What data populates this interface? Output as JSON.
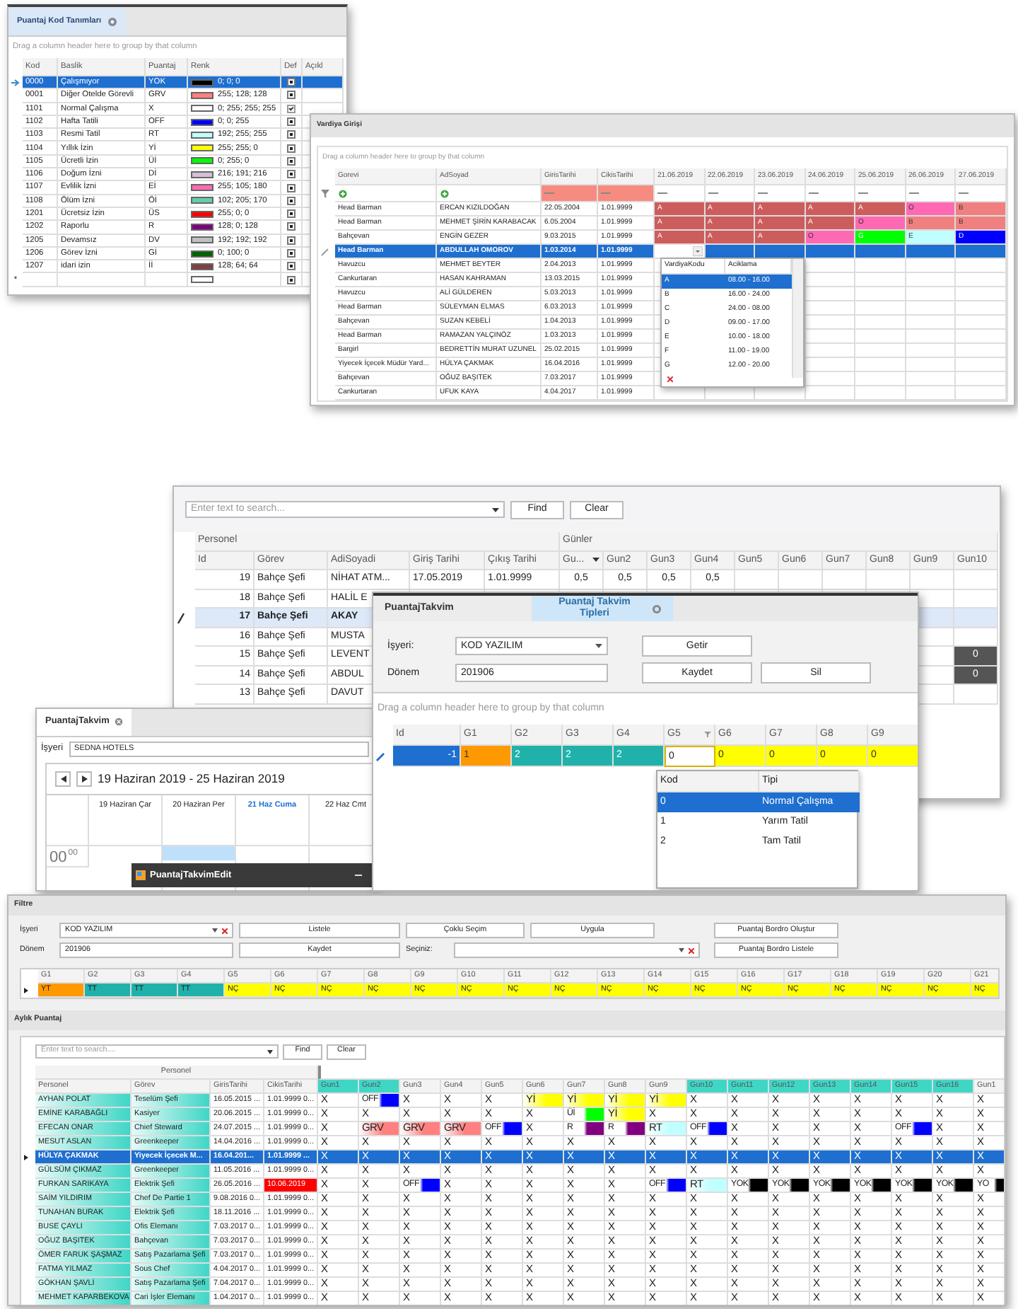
{
  "kod_tanimlari": {
    "tab": "Puantaj Kod Tanımları",
    "group_hint": "Drag a column header here to group by that column",
    "columns": [
      "Kod",
      "Baslik",
      "Puantaj",
      "Renk",
      "Def",
      "Açıkl"
    ],
    "rows": [
      {
        "kod": "0000",
        "baslik": "Çalışmıyor",
        "puantaj": "YOK",
        "color": "#000000",
        "renk": "0; 0; 0",
        "def": false,
        "selected": true
      },
      {
        "kod": "0001",
        "baslik": "Diğer Otelde Görevli",
        "puantaj": "GRV",
        "color": "#ff8080",
        "renk": "255; 128; 128",
        "def": false,
        "selected": false
      },
      {
        "kod": "1101",
        "baslik": "Normal Çalışma",
        "puantaj": "X",
        "color": "#ffffff",
        "renk": "0; 255; 255; 255",
        "def": true,
        "selected": false
      },
      {
        "kod": "1102",
        "baslik": "Hafta Tatili",
        "puantaj": "OFF",
        "color": "#0000ff",
        "renk": "0; 0; 255",
        "def": false,
        "selected": false
      },
      {
        "kod": "1103",
        "baslik": "Resmi Tatil",
        "puantaj": "RT",
        "color": "#c0ffff",
        "renk": "192; 255; 255",
        "def": false,
        "selected": false
      },
      {
        "kod": "1104",
        "baslik": "Yıllık İzin",
        "puantaj": "Yİ",
        "color": "#ffff00",
        "renk": "255; 255; 0",
        "def": false,
        "selected": false
      },
      {
        "kod": "1105",
        "baslik": "Ücretli İzin",
        "puantaj": "Üİ",
        "color": "#00ff00",
        "renk": "0; 255; 0",
        "def": false,
        "selected": false
      },
      {
        "kod": "1106",
        "baslik": "Doğum İzni",
        "puantaj": "Dİ",
        "color": "#d8bfd8",
        "renk": "216; 191; 216",
        "def": false,
        "selected": false
      },
      {
        "kod": "1107",
        "baslik": "Evlilik İzni",
        "puantaj": "Eİ",
        "color": "#ff69b4",
        "renk": "255; 105; 180",
        "def": false,
        "selected": false
      },
      {
        "kod": "1108",
        "baslik": "Ölüm İzni",
        "puantaj": "Öİ",
        "color": "#66cdaa",
        "renk": "102; 205; 170",
        "def": false,
        "selected": false
      },
      {
        "kod": "1201",
        "baslik": "Ücretsiz İzin",
        "puantaj": "ÜS",
        "color": "#ff0000",
        "renk": "255; 0; 0",
        "def": false,
        "selected": false
      },
      {
        "kod": "1202",
        "baslik": "Raporlu",
        "puantaj": "R",
        "color": "#800080",
        "renk": "128; 0; 128",
        "def": false,
        "selected": false
      },
      {
        "kod": "1205",
        "baslik": "Devamsız",
        "puantaj": "DV",
        "color": "#c0c0c0",
        "renk": "192; 192; 192",
        "def": false,
        "selected": false
      },
      {
        "kod": "1206",
        "baslik": "Görev İzni",
        "puantaj": "Gİ",
        "color": "#006400",
        "renk": "0; 100; 0",
        "def": false,
        "selected": false
      },
      {
        "kod": "1207",
        "baslik": "idari izin",
        "puantaj": "İİ",
        "color": "#804040",
        "renk": "128; 64; 64",
        "def": false,
        "selected": false
      }
    ],
    "new_row": {
      "marker": "*",
      "def": false
    }
  },
  "vardiya_girisi": {
    "title": "Vardiya Girişi",
    "group_hint": "Drag a column header here to group by that column",
    "columns": [
      "Gorevi",
      "AdSoyad",
      "GirisTarihi",
      "CikisTarihi",
      "21.06.2019",
      "22.06.2019",
      "23.06.2019",
      "24.06.2019",
      "25.06.2019",
      "26.06.2019",
      "27.06.2019"
    ],
    "rows": [
      {
        "gorevi": "Head Barman",
        "adsoyad": "ERCAN KIZILDOĞAN",
        "giris": "22.05.2004",
        "cikis": "1.01.9999",
        "selected": false,
        "editing": false,
        "shifts": [
          {
            "code": "A",
            "color": "#cd5c5c"
          },
          {
            "code": "A",
            "color": "#cd5c5c"
          },
          {
            "code": "A",
            "color": "#cd5c5c"
          },
          {
            "code": "A",
            "color": "#cd5c5c"
          },
          {
            "code": "A",
            "color": "#cd5c5c"
          },
          {
            "code": "O",
            "color": "#ff69b4"
          },
          {
            "code": "B",
            "color": "#f08080"
          }
        ]
      },
      {
        "gorevi": "Head Barman",
        "adsoyad": "MEHMET ŞİRİN KARABACAK",
        "giris": "6.05.2004",
        "cikis": "1.01.9999",
        "selected": false,
        "editing": false,
        "shifts": [
          {
            "code": "A",
            "color": "#cd5c5c"
          },
          {
            "code": "A",
            "color": "#cd5c5c"
          },
          {
            "code": "A",
            "color": "#cd5c5c"
          },
          {
            "code": "A",
            "color": "#cd5c5c"
          },
          {
            "code": "O",
            "color": "#ff69b4"
          },
          {
            "code": "B",
            "color": "#f08080"
          },
          {
            "code": "B",
            "color": "#f08080"
          }
        ]
      },
      {
        "gorevi": "Bahçevan",
        "adsoyad": "ENGİN GEZER",
        "giris": "9.03.2015",
        "cikis": "1.01.9999",
        "selected": false,
        "editing": false,
        "shifts": [
          {
            "code": "A",
            "color": "#cd5c5c"
          },
          {
            "code": "A",
            "color": "#cd5c5c"
          },
          {
            "code": "A",
            "color": "#cd5c5c"
          },
          {
            "code": "O",
            "color": "#ff69b4"
          },
          {
            "code": "G",
            "color": "#00ff00"
          },
          {
            "code": "E",
            "color": "#c0ffff"
          },
          {
            "code": "D",
            "color": "#0000ff"
          }
        ]
      },
      {
        "gorevi": "Head Barman",
        "adsoyad": "ABDULLAH OMOROV",
        "giris": "1.03.2014",
        "cikis": "1.01.9999",
        "selected": true,
        "editing": true,
        "shifts": []
      },
      {
        "gorevi": "Havuzcu",
        "adsoyad": "MEHMET BEYTER",
        "giris": "2.04.2013",
        "cikis": "1.01.9999",
        "selected": false,
        "editing": false,
        "shifts": []
      },
      {
        "gorevi": "Cankurtaran",
        "adsoyad": "HASAN KAHRAMAN",
        "giris": "13.03.2015",
        "cikis": "1.01.9999",
        "selected": false,
        "editing": false,
        "shifts": []
      },
      {
        "gorevi": "Havuzcu",
        "adsoyad": "ALİ GÜLDEREN",
        "giris": "5.03.2013",
        "cikis": "1.01.9999",
        "selected": false,
        "editing": false,
        "shifts": []
      },
      {
        "gorevi": "Head Barman",
        "adsoyad": "SÜLEYMAN ELMAS",
        "giris": "6.03.2013",
        "cikis": "1.01.9999",
        "selected": false,
        "editing": false,
        "shifts": []
      },
      {
        "gorevi": "Bahçevan",
        "adsoyad": "SUZAN KEBELİ",
        "giris": "1.04.2013",
        "cikis": "1.01.9999",
        "selected": false,
        "editing": false,
        "shifts": []
      },
      {
        "gorevi": "Head Barman",
        "adsoyad": "RAMAZAN YALÇINÖZ",
        "giris": "1.03.2013",
        "cikis": "1.01.9999",
        "selected": false,
        "editing": false,
        "shifts": []
      },
      {
        "gorevi": "Bargirl",
        "adsoyad": "BEDRETTİN MURAT UZUNEL",
        "giris": "25.02.2015",
        "cikis": "1.01.9999",
        "selected": false,
        "editing": false,
        "shifts": []
      },
      {
        "gorevi": "Yiyecek İçecek Müdür Yard...",
        "adsoyad": "HÜLYA ÇAKMAK",
        "giris": "16.04.2016",
        "cikis": "1.01.9999",
        "selected": false,
        "editing": false,
        "shifts": []
      },
      {
        "gorevi": "Bahçevan",
        "adsoyad": "OĞUZ BAŞITEK",
        "giris": "7.03.2017",
        "cikis": "1.01.9999",
        "selected": false,
        "editing": false,
        "shifts": []
      },
      {
        "gorevi": "Cankurtaran",
        "adsoyad": "UFUK KAYA",
        "giris": "4.04.2017",
        "cikis": "1.01.9999",
        "selected": false,
        "editing": false,
        "shifts": []
      }
    ],
    "dropdown": {
      "columns": [
        "VardiyaKodu",
        "Aciklama"
      ],
      "rows": [
        {
          "kod": "A",
          "aciklama": "08.00 - 16.00",
          "selected": true
        },
        {
          "kod": "B",
          "aciklama": "16.00 - 24.00",
          "selected": false
        },
        {
          "kod": "C",
          "aciklama": "24.00 - 08.00",
          "selected": false
        },
        {
          "kod": "D",
          "aciklama": "09.00 - 17.00",
          "selected": false
        },
        {
          "kod": "E",
          "aciklama": "10.00 - 18.00",
          "selected": false
        },
        {
          "kod": "F",
          "aciklama": "11.00 - 19.00",
          "selected": false
        },
        {
          "kod": "G",
          "aciklama": "12.00 - 20.00",
          "selected": false
        }
      ]
    }
  },
  "personel_gunler": {
    "search": {
      "placeholder": "Enter text to search..."
    },
    "find": "Find",
    "clear": "Clear",
    "bands": [
      "Personel",
      "Günler"
    ],
    "columns": [
      "Id",
      "Görev",
      "AdiSoyadi",
      "Giriş Tarihi",
      "Çıkış Tarihi",
      "Gu...",
      "Gun2",
      "Gun3",
      "Gun4",
      "Gun5",
      "Gun6",
      "Gun7",
      "Gun8",
      "Gun9",
      "Gun10"
    ],
    "rows": [
      {
        "id": "19",
        "gorev": "Bahçe Şefi",
        "adisoyadi": "NİHAT ATM...",
        "giris": "17.05.2019",
        "cikis": "1.01.9999",
        "gunler": [
          "0,5",
          "0,5",
          "0,5",
          "0,5"
        ],
        "selected": false
      },
      {
        "id": "18",
        "gorev": "Bahçe Şefi",
        "adisoyadi": "HALİL E",
        "selected": false
      },
      {
        "id": "17",
        "gorev": "Bahçe Şefi",
        "adisoyadi": "AKAY",
        "selected": true
      },
      {
        "id": "16",
        "gorev": "Bahçe Şefi",
        "adisoyadi": "MUSTA",
        "selected": false
      },
      {
        "id": "15",
        "gorev": "Bahçe Şefi",
        "adisoyadi": "LEVENT",
        "gun10": "0",
        "selected": false
      },
      {
        "id": "14",
        "gorev": "Bahçe Şefi",
        "adisoyadi": "ABDUL",
        "gun10": "0",
        "selected": false
      },
      {
        "id": "13",
        "gorev": "Bahçe Şefi",
        "adisoyadi": "DAVUT",
        "selected": false
      }
    ]
  },
  "takvim_tipleri": {
    "tabs": [
      {
        "label": "PuantajTakvim",
        "selected": false
      },
      {
        "label": "Puantaj Takvim Tipleri",
        "selected": true
      }
    ],
    "isyeri_label": "İşyeri:",
    "isyeri": "KOD YAZILIM",
    "donem_label": "Dönem",
    "donem": "201906",
    "buttons": {
      "getir": "Getir",
      "kaydet": "Kaydet",
      "sil": "Sil"
    },
    "group_hint": "Drag a column header here to group by that column",
    "columns": [
      "Id",
      "G1",
      "G2",
      "G3",
      "G4",
      "G5",
      "G6",
      "G7",
      "G8",
      "G9"
    ],
    "row": {
      "id": "-1",
      "cells": [
        {
          "text": "1",
          "color": "#ff9900"
        },
        {
          "text": "2",
          "color": "#20b2aa"
        },
        {
          "text": "2",
          "color": "#20b2aa"
        },
        {
          "text": "2",
          "color": "#20b2aa"
        },
        {
          "text": "0",
          "editing": true
        },
        {
          "text": "0",
          "color": "#ffff00"
        },
        {
          "text": "0",
          "color": "#ffff00"
        },
        {
          "text": "0",
          "color": "#ffff00"
        },
        {
          "text": "0",
          "color": "#ffff00"
        }
      ]
    },
    "dropdown": {
      "columns": [
        "Kod",
        "Tipi"
      ],
      "rows": [
        {
          "kod": "0",
          "tipi": "Normal Çalışma",
          "selected": true
        },
        {
          "kod": "1",
          "tipi": "Yarım Tatil",
          "selected": false
        },
        {
          "kod": "2",
          "tipi": "Tam Tatil",
          "selected": false
        }
      ]
    }
  },
  "takvim": {
    "tab": "PuantajTakvim",
    "isyeri_label": "İşyeri",
    "isyeri": "SEDNA HOTELS",
    "range": "19 Haziran 2019 - 25 Haziran 2019",
    "days": [
      {
        "label": "19 Haziran Çar",
        "today": false
      },
      {
        "label": "20 Haziran Per",
        "today": false
      },
      {
        "label": "21 Haz Cuma",
        "today": true
      },
      {
        "label": "22 Haz Cmt",
        "today": false
      }
    ],
    "hour": "00",
    "minutes": "00",
    "edit_window": "PuantajTakvimEdit"
  },
  "aylik": {
    "filtre_title": "Filtre",
    "isyeri_label": "İşyeri",
    "isyeri": "KOD YAZILIM",
    "donem_label": "Dönem",
    "donem": "201906",
    "seciniz_label": "Seçiniz:",
    "buttons": {
      "listele": "Listele",
      "coklu": "Çoklu Seçim",
      "uygula": "Uygula",
      "olustur": "Puantaj Bordro Oluştur",
      "kaydet": "Kaydet",
      "bordro_listele": "Puantaj Bordro Listele"
    },
    "g_columns": [
      "G1",
      "G2",
      "G3",
      "G4",
      "G5",
      "G6",
      "G7",
      "G8",
      "G9",
      "G10",
      "G11",
      "G12",
      "G13",
      "G14",
      "G15",
      "G16",
      "G17",
      "G18",
      "G19",
      "G20",
      "G21"
    ],
    "g_cells": [
      {
        "text": "YT",
        "color": "#ff9900"
      },
      {
        "text": "TT",
        "color": "#20b2aa"
      },
      {
        "text": "TT",
        "color": "#20b2aa"
      },
      {
        "text": "TT",
        "color": "#20b2aa"
      },
      {
        "text": "NÇ",
        "color": "#ffff00"
      },
      {
        "text": "NÇ",
        "color": "#ffff00"
      },
      {
        "text": "NÇ",
        "color": "#ffff00"
      },
      {
        "text": "NÇ",
        "color": "#ffff00"
      },
      {
        "text": "NÇ",
        "color": "#ffff00"
      },
      {
        "text": "NÇ",
        "color": "#ffff00"
      },
      {
        "text": "NÇ",
        "color": "#ffff00"
      },
      {
        "text": "NÇ",
        "color": "#ffff00"
      },
      {
        "text": "NÇ",
        "color": "#ffff00"
      },
      {
        "text": "NÇ",
        "color": "#ffff00"
      },
      {
        "text": "NÇ",
        "color": "#ffff00"
      },
      {
        "text": "NÇ",
        "color": "#ffff00"
      },
      {
        "text": "NÇ",
        "color": "#ffff00"
      },
      {
        "text": "NÇ",
        "color": "#ffff00"
      },
      {
        "text": "NÇ",
        "color": "#ffff00"
      },
      {
        "text": "NÇ",
        "color": "#ffff00"
      },
      {
        "text": "NÇ",
        "color": "#ffff00"
      }
    ],
    "puantaj_title": "Aylık Puantaj",
    "search": {
      "placeholder": "Enter text to search...."
    },
    "find": "Find",
    "clear": "Clear",
    "band": "Personel",
    "columns": [
      "Personel",
      "Görev",
      "GirisTarihi",
      "CikisTarihi"
    ],
    "gun_columns": [
      {
        "label": "Gun1",
        "highlight": true
      },
      {
        "label": "Gun2",
        "highlight": true
      },
      {
        "label": "Gun3",
        "highlight": false
      },
      {
        "label": "Gun4",
        "highlight": false
      },
      {
        "label": "Gun5",
        "highlight": false
      },
      {
        "label": "Gun6",
        "highlight": false
      },
      {
        "label": "Gun7",
        "highlight": false
      },
      {
        "label": "Gun8",
        "highlight": false
      },
      {
        "label": "Gun9",
        "highlight": false
      },
      {
        "label": "Gun10",
        "highlight": true
      },
      {
        "label": "Gun11",
        "highlight": true
      },
      {
        "label": "Gun12",
        "highlight": true
      },
      {
        "label": "Gun13",
        "highlight": true
      },
      {
        "label": "Gun14",
        "highlight": true
      },
      {
        "label": "Gun15",
        "highlight": true
      },
      {
        "label": "Gun16",
        "highlight": true
      },
      {
        "label": "Gun1",
        "highlight": false
      }
    ],
    "rows": [
      {
        "personel": "AYHAN POLAT",
        "gorev": "Teselüm Şefi",
        "giris": "16.05.2015 ...",
        "cikis": "1.01.9999 0...",
        "selected": false,
        "cikis_alert": false,
        "days": [
          "X",
          {
            "text": "OFF",
            "color": "#0000ff"
          },
          "X",
          "X",
          "X",
          {
            "text": "Yİ",
            "color": "#ffff00"
          },
          {
            "text": "Yİ",
            "color": "#ffff00"
          },
          {
            "text": "Yİ",
            "color": "#ffff00"
          },
          {
            "text": "Yİ",
            "color": "#ffff00"
          },
          "X",
          "X",
          "X",
          "X",
          "X",
          "X",
          "X",
          "X"
        ]
      },
      {
        "personel": "EMİNE KARABAĞLI",
        "gorev": "Kasiyer",
        "giris": "20.06.2015 ...",
        "cikis": "1.01.9999 0...",
        "selected": false,
        "cikis_alert": false,
        "days": [
          "X",
          "X",
          "X",
          "X",
          "X",
          "X",
          {
            "text": "Üİ",
            "color": "#00ff00"
          },
          {
            "text": "Yİ",
            "color": "#ffff00"
          },
          "X",
          "X",
          "X",
          "X",
          "X",
          "X",
          "X",
          "X",
          "X"
        ]
      },
      {
        "personel": "EFECAN ONAR",
        "gorev": "Chief Steward",
        "giris": "24.07.2015 ...",
        "cikis": "1.01.9999 0...",
        "selected": false,
        "cikis_alert": false,
        "days": [
          "X",
          {
            "text": "GRV",
            "color": "#ff8080"
          },
          {
            "text": "GRV",
            "color": "#ff8080"
          },
          {
            "text": "GRV",
            "color": "#ff8080"
          },
          {
            "text": "OFF",
            "color": "#0000ff"
          },
          "X",
          {
            "text": "R",
            "color": "#800080"
          },
          {
            "text": "R",
            "color": "#800080"
          },
          {
            "text": "RT",
            "color": "#c0ffff"
          },
          {
            "text": "OFF",
            "color": "#0000ff"
          },
          "X",
          "X",
          "X",
          "X",
          {
            "text": "OFF",
            "color": "#0000ff"
          },
          "X",
          "X"
        ]
      },
      {
        "personel": "MESUT ASLAN",
        "gorev": "Greenkeeper",
        "giris": "14.04.2016 ...",
        "cikis": "1.01.9999 0...",
        "selected": false,
        "cikis_alert": false,
        "days": [
          "X",
          "X",
          "X",
          "X",
          "X",
          "X",
          "X",
          "X",
          "X",
          "X",
          "X",
          "X",
          "X",
          "X",
          "X",
          "X",
          "X"
        ]
      },
      {
        "personel": "HÜLYA ÇAKMAK",
        "gorev": "Yiyecek İçecek M...",
        "giris": "16.04.201...",
        "cikis": "1.01.9999 ...",
        "selected": true,
        "cikis_alert": false,
        "days": [
          "X",
          "X",
          "X",
          "X",
          "X",
          "X",
          "X",
          "X",
          "X",
          "X",
          "X",
          "X",
          "X",
          "X",
          "X",
          "X",
          "X"
        ]
      },
      {
        "personel": "GÜLSÜM ÇIKMAZ",
        "gorev": "Greenkeeper",
        "giris": "11.05.2016 ...",
        "cikis": "1.01.9999 0...",
        "selected": false,
        "cikis_alert": false,
        "days": [
          "X",
          "X",
          "X",
          "X",
          "X",
          "X",
          "X",
          "X",
          "X",
          "X",
          "X",
          "X",
          "X",
          "X",
          "X",
          "X",
          "X"
        ]
      },
      {
        "personel": "FURKAN SARIKAYA",
        "gorev": "Elektrik Şefi",
        "giris": "26.05.2016 ...",
        "cikis": "10.06.2019",
        "selected": false,
        "cikis_alert": true,
        "days": [
          "X",
          "X",
          {
            "text": "OFF",
            "color": "#0000ff"
          },
          "X",
          "X",
          "X",
          "X",
          "X",
          {
            "text": "OFF",
            "color": "#0000ff"
          },
          {
            "text": "RT",
            "color": "#c0ffff"
          },
          {
            "text": "YOK",
            "color": "#000000"
          },
          {
            "text": "YOK",
            "color": "#000000"
          },
          {
            "text": "YOK",
            "color": "#000000"
          },
          {
            "text": "YOK",
            "color": "#000000"
          },
          {
            "text": "YOK",
            "color": "#000000"
          },
          {
            "text": "YOK",
            "color": "#000000"
          },
          {
            "text": "YO",
            "color": "#000000"
          }
        ]
      },
      {
        "personel": "SAİM YILDIRIM",
        "gorev": "Chef De Partie 1",
        "giris": "9.08.2016 0...",
        "cikis": "1.01.9999 0...",
        "selected": false,
        "cikis_alert": false,
        "days": [
          "X",
          "X",
          "X",
          "X",
          "X",
          "X",
          "X",
          "X",
          "X",
          "X",
          "X",
          "X",
          "X",
          "X",
          "X",
          "X",
          "X"
        ]
      },
      {
        "personel": "TUNAHAN BURAK",
        "gorev": "Elektrik Şefi",
        "giris": "18.11.2016 ...",
        "cikis": "1.01.9999 0...",
        "selected": false,
        "cikis_alert": false,
        "days": [
          "X",
          "X",
          "X",
          "X",
          "X",
          "X",
          "X",
          "X",
          "X",
          "X",
          "X",
          "X",
          "X",
          "X",
          "X",
          "X",
          "X"
        ]
      },
      {
        "personel": "BUSE ÇAYLI",
        "gorev": "Ofis Elemanı",
        "giris": "7.03.2017 0...",
        "cikis": "1.01.9999 0...",
        "selected": false,
        "cikis_alert": false,
        "days": [
          "X",
          "X",
          "X",
          "X",
          "X",
          "X",
          "X",
          "X",
          "X",
          "X",
          "X",
          "X",
          "X",
          "X",
          "X",
          "X",
          "X"
        ]
      },
      {
        "personel": "OĞUZ BAŞITEK",
        "gorev": "Bahçevan",
        "giris": "7.03.2017 0...",
        "cikis": "1.01.9999 0...",
        "selected": false,
        "cikis_alert": false,
        "days": [
          "X",
          "X",
          "X",
          "X",
          "X",
          "X",
          "X",
          "X",
          "X",
          "X",
          "X",
          "X",
          "X",
          "X",
          "X",
          "X",
          "X"
        ]
      },
      {
        "personel": "ÖMER FARUK ŞAŞMAZ",
        "gorev": "Satış Pazarlama Şefi",
        "giris": "7.03.2017 0...",
        "cikis": "1.01.9999 0...",
        "selected": false,
        "cikis_alert": false,
        "days": [
          "X",
          "X",
          "X",
          "X",
          "X",
          "X",
          "X",
          "X",
          "X",
          "X",
          "X",
          "X",
          "X",
          "X",
          "X",
          "X",
          "X"
        ]
      },
      {
        "personel": "FATMA YILMAZ",
        "gorev": "Sous Chef",
        "giris": "4.04.2017 0...",
        "cikis": "1.01.9999 0...",
        "selected": false,
        "cikis_alert": false,
        "days": [
          "X",
          "X",
          "X",
          "X",
          "X",
          "X",
          "X",
          "X",
          "X",
          "X",
          "X",
          "X",
          "X",
          "X",
          "X",
          "X",
          "X"
        ]
      },
      {
        "personel": "GÖKHAN ŞAVLİ",
        "gorev": "Satış Pazarlama Şefi",
        "giris": "7.04.2017 0...",
        "cikis": "1.01.9999 0...",
        "selected": false,
        "cikis_alert": false,
        "days": [
          "X",
          "X",
          "X",
          "X",
          "X",
          "X",
          "X",
          "X",
          "X",
          "X",
          "X",
          "X",
          "X",
          "X",
          "X",
          "X",
          "X"
        ]
      },
      {
        "personel": "MEHMET KAPARBEKOVA",
        "gorev": "Cari İşler Elemanı",
        "giris": "1.04.2017 0...",
        "cikis": "1.01.9999 0...",
        "selected": false,
        "cikis_alert": false,
        "days": [
          "X",
          "X",
          "X",
          "X",
          "X",
          "X",
          "X",
          "X",
          "X",
          "X",
          "X",
          "X",
          "X",
          "X",
          "X",
          "X",
          "X"
        ]
      }
    ]
  }
}
